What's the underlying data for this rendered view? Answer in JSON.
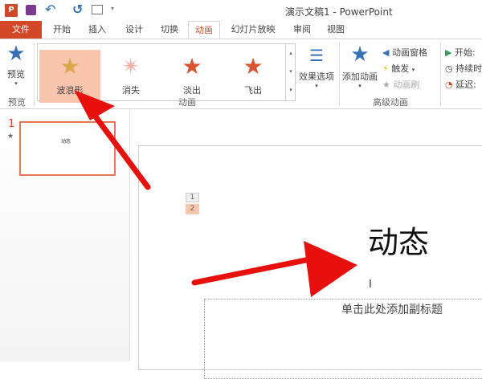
{
  "window": {
    "title": "演示文稿1 - PowerPoint"
  },
  "qat": {
    "app_icon": "P",
    "save": "save-icon",
    "undo": "undo-icon",
    "redo": "redo-icon",
    "present": "present-icon",
    "more": "▾"
  },
  "tabs": [
    "文件",
    "开始",
    "插入",
    "设计",
    "切换",
    "动画",
    "幻灯片放映",
    "审阅",
    "视图"
  ],
  "active_tab": "动画",
  "ribbon": {
    "preview": {
      "label": "预览",
      "group": "预览"
    },
    "gallery": {
      "items": [
        "波浪形",
        "消失",
        "淡出",
        "飞出"
      ],
      "selected": "波浪形",
      "group": "动画"
    },
    "effect_options": "效果选项",
    "advanced": {
      "add_animation": "添加动画",
      "pane": "动画窗格",
      "trigger": "触发",
      "painter": "动画刷",
      "group": "高级动画"
    },
    "timing": {
      "start": "开始:",
      "duration": "持续时",
      "delay": "延迟:"
    }
  },
  "slides_pane": {
    "number": "1",
    "thumb_text": "动态"
  },
  "slide": {
    "markers": [
      "1",
      "2"
    ],
    "title": "动态",
    "subtitle_placeholder": "单击此处添加副标题",
    "cursor": "I"
  },
  "colors": {
    "accent": "#d24726",
    "selected": "#f9c5ad"
  }
}
